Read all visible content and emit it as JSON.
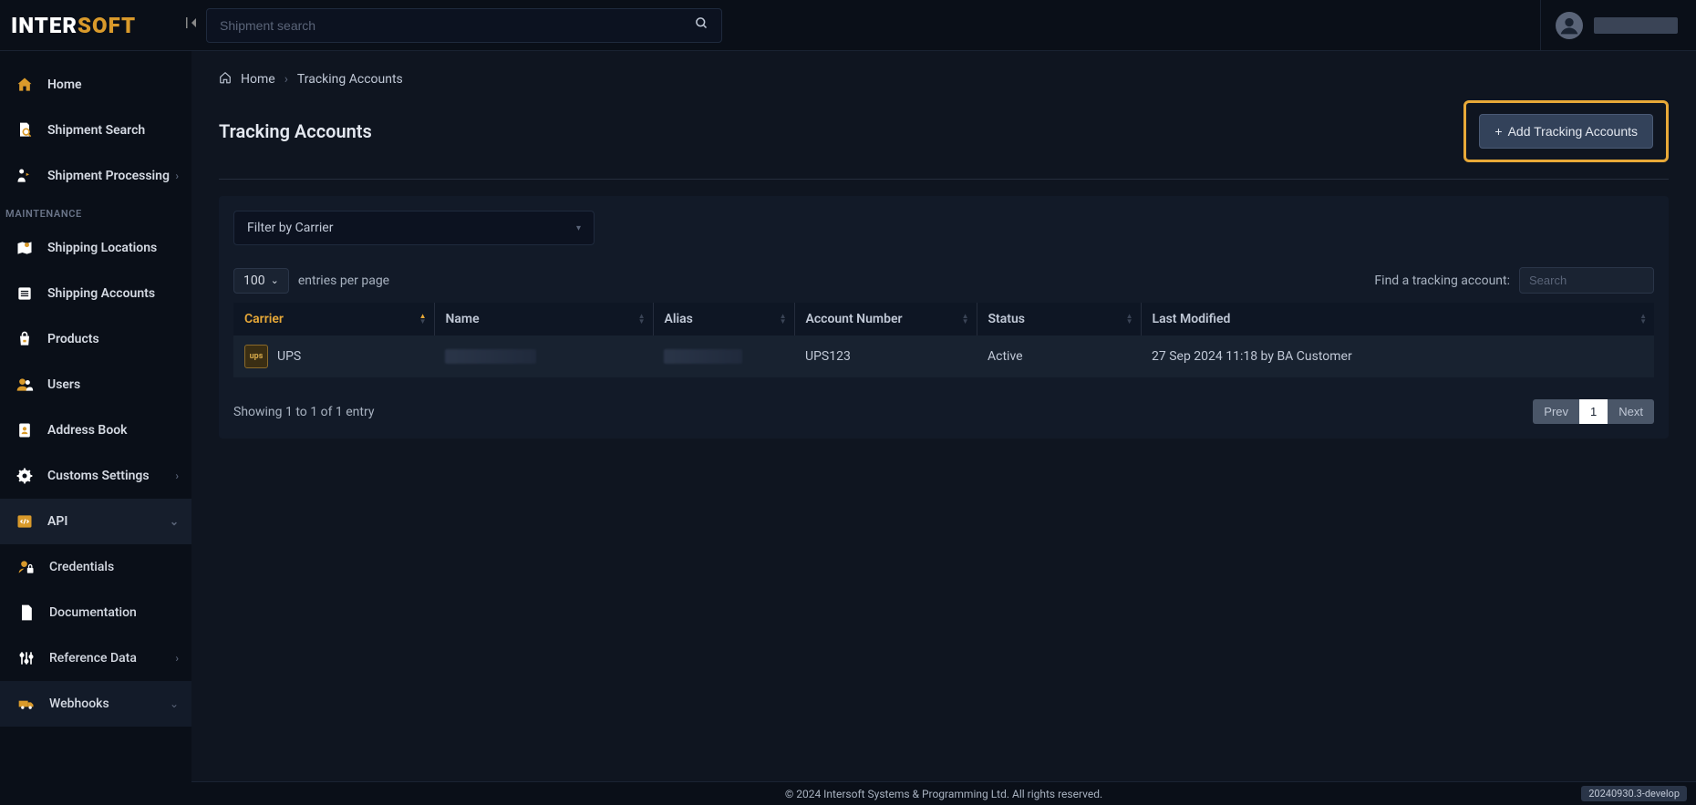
{
  "header": {
    "logo_part1": "INTER",
    "logo_part2": "SOFT",
    "search_placeholder": "Shipment search"
  },
  "sidebar": {
    "items": [
      {
        "label": "Home",
        "icon": "home"
      },
      {
        "label": "Shipment Search",
        "icon": "file-search"
      },
      {
        "label": "Shipment Processing",
        "icon": "processing",
        "chevron": true
      }
    ],
    "section_label": "MAINTENANCE",
    "maintenance": [
      {
        "label": "Shipping Locations",
        "icon": "map-pin"
      },
      {
        "label": "Shipping Accounts",
        "icon": "list"
      },
      {
        "label": "Products",
        "icon": "bag"
      },
      {
        "label": "Users",
        "icon": "users"
      },
      {
        "label": "Address Book",
        "icon": "address"
      },
      {
        "label": "Customs Settings",
        "icon": "gear",
        "chevron": true
      },
      {
        "label": "API",
        "icon": "code",
        "chevron": true,
        "expanded": true
      }
    ],
    "api_sub": [
      {
        "label": "Credentials",
        "icon": "user-lock"
      },
      {
        "label": "Documentation",
        "icon": "file"
      },
      {
        "label": "Reference Data",
        "icon": "sliders",
        "chevron": true
      },
      {
        "label": "Webhooks",
        "icon": "truck",
        "chevron": true
      }
    ]
  },
  "breadcrumb": {
    "home": "Home",
    "current": "Tracking Accounts"
  },
  "page": {
    "title": "Tracking Accounts",
    "add_button": "Add Tracking Accounts"
  },
  "filter": {
    "label": "Filter by Carrier"
  },
  "table_controls": {
    "entries_value": "100",
    "entries_label": "entries per page",
    "search_label": "Find a tracking account:",
    "search_placeholder": "Search"
  },
  "table": {
    "headers": [
      "Carrier",
      "Name",
      "Alias",
      "Account Number",
      "Status",
      "Last Modified"
    ],
    "row": {
      "carrier": "UPS",
      "carrier_badge": "ups",
      "account_number": "UPS123",
      "status": "Active",
      "last_modified": "27 Sep 2024 11:18 by BA Customer"
    }
  },
  "table_footer": {
    "info": "Showing 1 to 1 of 1 entry",
    "prev": "Prev",
    "current_page": "1",
    "next": "Next"
  },
  "footer": {
    "copyright": "© 2024 Intersoft Systems & Programming Ltd. All rights reserved.",
    "version": "20240930.3-develop"
  }
}
